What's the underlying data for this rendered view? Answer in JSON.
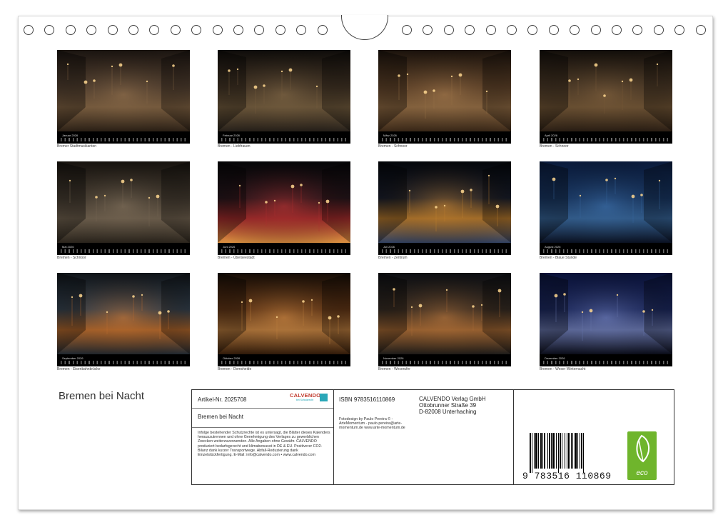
{
  "calendar": {
    "title": "Bremen bei Nacht",
    "year": "2026",
    "months": [
      {
        "month": "Januar",
        "caption": "Bremer Stadtmusikanten",
        "colors": [
          "#1a1410",
          "#5a4636",
          "#8a6a48",
          "#2b2016"
        ]
      },
      {
        "month": "Februar",
        "caption": "Bremen - Liebfrauen",
        "colors": [
          "#0e0c0a",
          "#4a3a2a",
          "#7a6242",
          "#26201a"
        ]
      },
      {
        "month": "März",
        "caption": "Bremen - Schnoor",
        "colors": [
          "#1a120c",
          "#6a4a2e",
          "#9a7248",
          "#3a2818"
        ]
      },
      {
        "month": "April",
        "caption": "Bremen - Schnoor",
        "colors": [
          "#120e0a",
          "#54402c",
          "#7a5c3a",
          "#2a1e14"
        ]
      },
      {
        "month": "Mai",
        "caption": "Bremen - Schnoor",
        "colors": [
          "#16120e",
          "#4c4236",
          "#7a6a56",
          "#2a241c"
        ]
      },
      {
        "month": "Juni",
        "caption": "Bremen - Überseestadt",
        "colors": [
          "#050507",
          "#2a1a20",
          "#b03030",
          "#d89040"
        ]
      },
      {
        "month": "Juli",
        "caption": "Bremen - Zentrum",
        "colors": [
          "#04060a",
          "#1a2030",
          "#c08030",
          "#304060"
        ]
      },
      {
        "month": "August",
        "caption": "Bremen - Blaue Stunde",
        "colors": [
          "#0a1a3a",
          "#1a3a6a",
          "#3a6aa0",
          "#0a1020"
        ]
      },
      {
        "month": "September",
        "caption": "Bremen - Eisenbahnbrücke",
        "colors": [
          "#101418",
          "#3a4a5a",
          "#c07030",
          "#202830"
        ]
      },
      {
        "month": "Oktober",
        "caption": "Bremen - Domsheide",
        "colors": [
          "#140c06",
          "#6a3a18",
          "#c08040",
          "#301a0a"
        ]
      },
      {
        "month": "November",
        "caption": "Bremen - Weserufer",
        "colors": [
          "#0c0e12",
          "#3a3028",
          "#b07038",
          "#1e1c1a"
        ]
      },
      {
        "month": "Dezember",
        "caption": "Bremen - Weser Winternacht",
        "colors": [
          "#0a1238",
          "#1e2c68",
          "#6a78b0",
          "#0a0c18"
        ]
      }
    ]
  },
  "info": {
    "article": "Artikel-Nr. 2025708",
    "brand": "CALVENDO",
    "brand_sub": "bei Schutzrecht",
    "product_title": "Bremen bei Nacht",
    "legal": "Infolge bestehender Schutzrechte ist es untersagt, die Blätter dieses Kalenders herauszutrennen und ohne Genehmigung des Verlages zu gewerblichen Zwecken weiterzuverwenden. Alle Angaben ohne Gewähr. CALVENDO produziert bedarfsgerecht und klimabewusst in DE & EU. Positiverer CO2-Bilanz dank kurzer Transportwege. Abfall-Reduzierung dank Einzelstückfertigung. E-Mail: info@calvendo.com • www.calvendo.com",
    "isbn": "ISBN 9783516110869",
    "credits": "Fotodesign by Paulo Pereira © - ArteMomentum - paulo.pereira@arte-momentum.de www.arte-momentum.de",
    "publisher_name": "CALVENDO Verlag GmbH",
    "publisher_street": "Ottobrunner Straße 39",
    "publisher_city": "D-82008 Unterhaching",
    "barcode_number": "9 783516 110869",
    "eco_label": "eco"
  }
}
